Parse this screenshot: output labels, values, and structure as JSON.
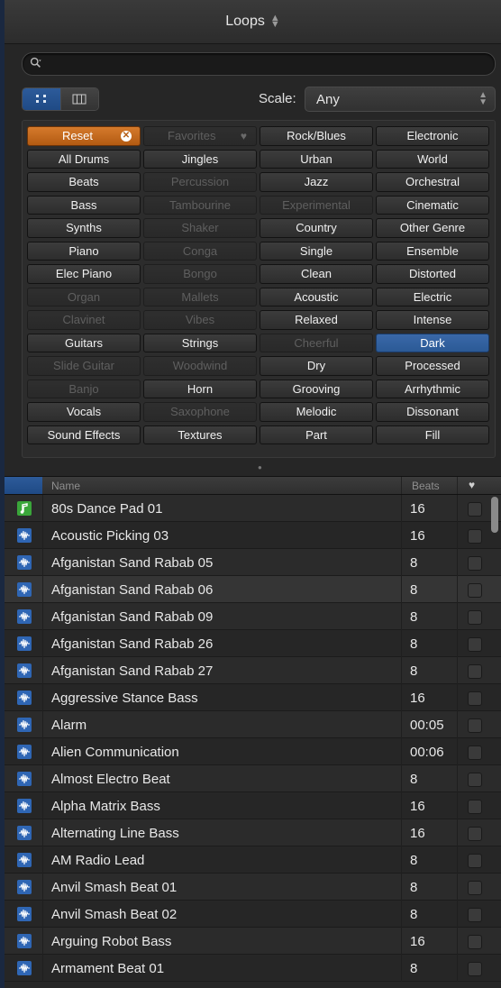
{
  "header": {
    "title": "Loops"
  },
  "search": {
    "placeholder": ""
  },
  "scale": {
    "label": "Scale:",
    "value": "Any"
  },
  "keywords": [
    {
      "label": "Reset",
      "state": "reset"
    },
    {
      "label": "Favorites",
      "state": "disabled",
      "fav": true
    },
    {
      "label": "Rock/Blues",
      "state": "normal"
    },
    {
      "label": "Electronic",
      "state": "normal"
    },
    {
      "label": "All Drums",
      "state": "normal"
    },
    {
      "label": "Jingles",
      "state": "normal"
    },
    {
      "label": "Urban",
      "state": "normal"
    },
    {
      "label": "World",
      "state": "normal"
    },
    {
      "label": "Beats",
      "state": "normal"
    },
    {
      "label": "Percussion",
      "state": "disabled"
    },
    {
      "label": "Jazz",
      "state": "normal"
    },
    {
      "label": "Orchestral",
      "state": "normal"
    },
    {
      "label": "Bass",
      "state": "normal"
    },
    {
      "label": "Tambourine",
      "state": "disabled"
    },
    {
      "label": "Experimental",
      "state": "disabled"
    },
    {
      "label": "Cinematic",
      "state": "normal"
    },
    {
      "label": "Synths",
      "state": "normal"
    },
    {
      "label": "Shaker",
      "state": "disabled"
    },
    {
      "label": "Country",
      "state": "normal"
    },
    {
      "label": "Other Genre",
      "state": "normal"
    },
    {
      "label": "Piano",
      "state": "normal"
    },
    {
      "label": "Conga",
      "state": "disabled"
    },
    {
      "label": "Single",
      "state": "normal"
    },
    {
      "label": "Ensemble",
      "state": "normal"
    },
    {
      "label": "Elec Piano",
      "state": "normal"
    },
    {
      "label": "Bongo",
      "state": "disabled"
    },
    {
      "label": "Clean",
      "state": "normal"
    },
    {
      "label": "Distorted",
      "state": "normal"
    },
    {
      "label": "Organ",
      "state": "disabled"
    },
    {
      "label": "Mallets",
      "state": "disabled"
    },
    {
      "label": "Acoustic",
      "state": "normal"
    },
    {
      "label": "Electric",
      "state": "normal"
    },
    {
      "label": "Clavinet",
      "state": "disabled"
    },
    {
      "label": "Vibes",
      "state": "disabled"
    },
    {
      "label": "Relaxed",
      "state": "normal"
    },
    {
      "label": "Intense",
      "state": "normal"
    },
    {
      "label": "Guitars",
      "state": "normal"
    },
    {
      "label": "Strings",
      "state": "normal"
    },
    {
      "label": "Cheerful",
      "state": "disabled"
    },
    {
      "label": "Dark",
      "state": "selected"
    },
    {
      "label": "Slide Guitar",
      "state": "disabled"
    },
    {
      "label": "Woodwind",
      "state": "disabled"
    },
    {
      "label": "Dry",
      "state": "normal"
    },
    {
      "label": "Processed",
      "state": "normal"
    },
    {
      "label": "Banjo",
      "state": "disabled"
    },
    {
      "label": "Horn",
      "state": "normal"
    },
    {
      "label": "Grooving",
      "state": "normal"
    },
    {
      "label": "Arrhythmic",
      "state": "normal"
    },
    {
      "label": "Vocals",
      "state": "normal"
    },
    {
      "label": "Saxophone",
      "state": "disabled"
    },
    {
      "label": "Melodic",
      "state": "normal"
    },
    {
      "label": "Dissonant",
      "state": "normal"
    },
    {
      "label": "Sound Effects",
      "state": "normal"
    },
    {
      "label": "Textures",
      "state": "normal"
    },
    {
      "label": "Part",
      "state": "normal"
    },
    {
      "label": "Fill",
      "state": "normal"
    }
  ],
  "columns": {
    "name": "Name",
    "beats": "Beats"
  },
  "loops": [
    {
      "name": "80s Dance Pad 01",
      "beats": "16",
      "icon": "software-instrument-icon"
    },
    {
      "name": "Acoustic Picking 03",
      "beats": "16",
      "icon": "audio-waveform-icon"
    },
    {
      "name": "Afganistan Sand Rabab 05",
      "beats": "8",
      "icon": "audio-waveform-icon"
    },
    {
      "name": "Afganistan Sand Rabab 06",
      "beats": "8",
      "icon": "audio-waveform-icon",
      "selected": true
    },
    {
      "name": "Afganistan Sand Rabab 09",
      "beats": "8",
      "icon": "audio-waveform-icon"
    },
    {
      "name": "Afganistan Sand Rabab 26",
      "beats": "8",
      "icon": "audio-waveform-icon"
    },
    {
      "name": "Afganistan Sand Rabab 27",
      "beats": "8",
      "icon": "audio-waveform-icon"
    },
    {
      "name": "Aggressive Stance Bass",
      "beats": "16",
      "icon": "audio-waveform-icon"
    },
    {
      "name": "Alarm",
      "beats": "00:05",
      "icon": "audio-waveform-icon"
    },
    {
      "name": "Alien Communication",
      "beats": "00:06",
      "icon": "audio-waveform-icon"
    },
    {
      "name": "Almost Electro Beat",
      "beats": "8",
      "icon": "audio-waveform-icon"
    },
    {
      "name": "Alpha Matrix Bass",
      "beats": "16",
      "icon": "audio-waveform-icon"
    },
    {
      "name": "Alternating Line Bass",
      "beats": "16",
      "icon": "audio-waveform-icon"
    },
    {
      "name": "AM Radio Lead",
      "beats": "8",
      "icon": "audio-waveform-icon"
    },
    {
      "name": "Anvil Smash Beat 01",
      "beats": "8",
      "icon": "audio-waveform-icon"
    },
    {
      "name": "Anvil Smash Beat 02",
      "beats": "8",
      "icon": "audio-waveform-icon"
    },
    {
      "name": "Arguing Robot Bass",
      "beats": "16",
      "icon": "audio-waveform-icon"
    },
    {
      "name": "Armament Beat 01",
      "beats": "8",
      "icon": "audio-waveform-icon"
    }
  ],
  "colors": {
    "accent_blue": "#2f66b4",
    "reset_orange": "#c96a1e",
    "green_icon": "#3aa63a"
  }
}
